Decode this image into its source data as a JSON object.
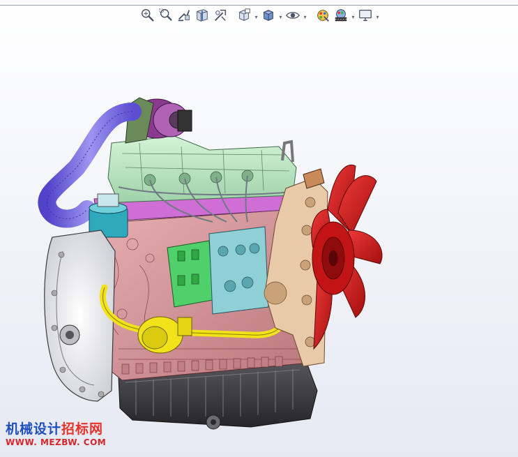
{
  "toolbar": {
    "items": [
      {
        "name": "zoom-to-fit-icon",
        "dropdown": false
      },
      {
        "name": "zoom-to-area-icon",
        "dropdown": false
      },
      {
        "name": "previous-view-icon",
        "dropdown": false
      },
      {
        "name": "section-view-icon",
        "dropdown": false
      },
      {
        "name": "dynamic-annotation-icon",
        "dropdown": false
      },
      {
        "name": "view-orientation-icon",
        "dropdown": true
      },
      {
        "name": "display-style-icon",
        "dropdown": true
      },
      {
        "name": "hide-show-items-icon",
        "dropdown": true
      },
      {
        "name": "edit-appearance-icon",
        "dropdown": false
      },
      {
        "name": "apply-scene-icon",
        "dropdown": true
      },
      {
        "name": "view-settings-icon",
        "dropdown": true
      }
    ]
  },
  "watermark": {
    "part1": "机械设计",
    "part2": "招标网",
    "url": "WWW. MEZBW. COM"
  },
  "colors": {
    "background_top": "#ffffff",
    "background_bottom": "#e7e9f2",
    "fan": "#d11a1a",
    "valve_cover": "#b8e6c0",
    "intake_pipe": "#7a6fe0",
    "block": "#d99a9e",
    "flywheel_housing": "#f2f2f4",
    "oil_pan": "#3c3c40",
    "fuel_pump": "#4fd06a",
    "injection_pump": "#8fcfd6",
    "yellow_hose": "#f2e21a",
    "filter": "#2fa9bb",
    "turbo": "#8a3a8f",
    "timing_cover": "#e8c9a8"
  }
}
